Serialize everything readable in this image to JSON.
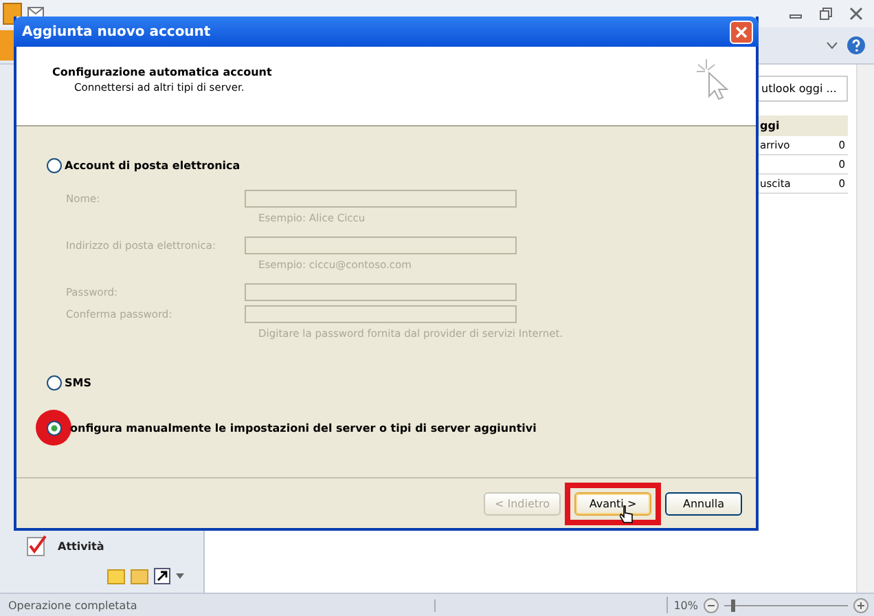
{
  "outlook": {
    "today_header": "utlook oggi ...",
    "today_section": "ggi",
    "today_rows": [
      {
        "label": "arrivo",
        "count": "0"
      },
      {
        "label": "",
        "count": "0"
      },
      {
        "label": "uscita",
        "count": "0"
      }
    ],
    "nav_item": "Attività"
  },
  "dialog": {
    "title": "Aggiunta nuovo account",
    "heading": "Configurazione automatica account",
    "subheading": "Connettersi ad altri tipi di server.",
    "options": [
      {
        "label": "Account di posta elettronica",
        "selected": false,
        "highlighted": false
      },
      {
        "label": "SMS",
        "selected": false,
        "highlighted": false
      },
      {
        "label": "onfigura manualmente le impostazioni del server o tipi di server aggiuntivi",
        "selected": true,
        "highlighted": true
      }
    ],
    "fields": [
      {
        "label": "Nome:",
        "hint": "Esempio: Alice Ciccu",
        "disabled": true
      },
      {
        "label": "Indirizzo di posta elettronica:",
        "hint": "Esempio: ciccu@contoso.com",
        "disabled": true
      },
      {
        "label": "Password:",
        "disabled": true
      },
      {
        "label": "Conferma password:",
        "hint": "Digitare la password fornita dal provider di servizi Internet.",
        "disabled": true
      }
    ],
    "buttons": [
      {
        "label": "< Indietro",
        "disabled": true,
        "highlighted": false
      },
      {
        "label": "Avanti >",
        "disabled": false,
        "highlighted": true
      },
      {
        "label": "Annulla",
        "disabled": false,
        "highlighted": false
      }
    ]
  },
  "status_bar": {
    "text": "Operazione completata",
    "zoom": "10%",
    "zoom_slider": {
      "level": 0.05
    }
  }
}
